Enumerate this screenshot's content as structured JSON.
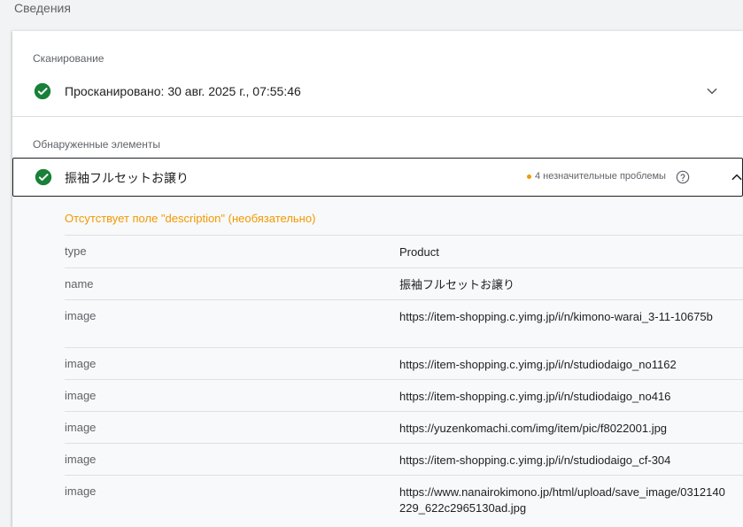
{
  "page": {
    "title": "Сведения"
  },
  "crawl": {
    "section_label": "Сканирование",
    "status_text": "Просканировано: 30 авг. 2025 г., 07:55:46"
  },
  "detected": {
    "section_label": "Обнаруженные элементы",
    "item_name": "振袖フルセットお譲り",
    "issues_text": "4 незначительные проблемы",
    "warning_text": "Отсутствует поле \"description\" (необязательно)",
    "properties": [
      {
        "key": "type",
        "value": "Product"
      },
      {
        "key": "name",
        "value": "振袖フルセットお譲り"
      },
      {
        "key": "image",
        "value": "https://item-shopping.c.yimg.jp/i/n/kimono-warai_3-11-10675b"
      },
      {
        "key": "image",
        "value": "https://item-shopping.c.yimg.jp/i/n/studiodaigo_no1162"
      },
      {
        "key": "image",
        "value": "https://item-shopping.c.yimg.jp/i/n/studiodaigo_no416"
      },
      {
        "key": "image",
        "value": "https://yuzenkomachi.com/img/item/pic/f8022001.jpg"
      },
      {
        "key": "image",
        "value": "https://item-shopping.c.yimg.jp/i/n/studiodaigo_cf-304"
      },
      {
        "key": "image",
        "value": "https://www.nanairokimono.jp/html/upload/save_image/0312140229_622c2965130ad.jpg"
      }
    ]
  },
  "colors": {
    "valid_green": "#188038",
    "warning_orange": "#f29900",
    "text_primary": "#202124",
    "text_secondary": "#5f6368"
  },
  "icons": {
    "valid": "check-circle-icon",
    "expand": "chevron-down-icon",
    "collapse": "chevron-up-icon",
    "help": "help-circle-icon"
  }
}
